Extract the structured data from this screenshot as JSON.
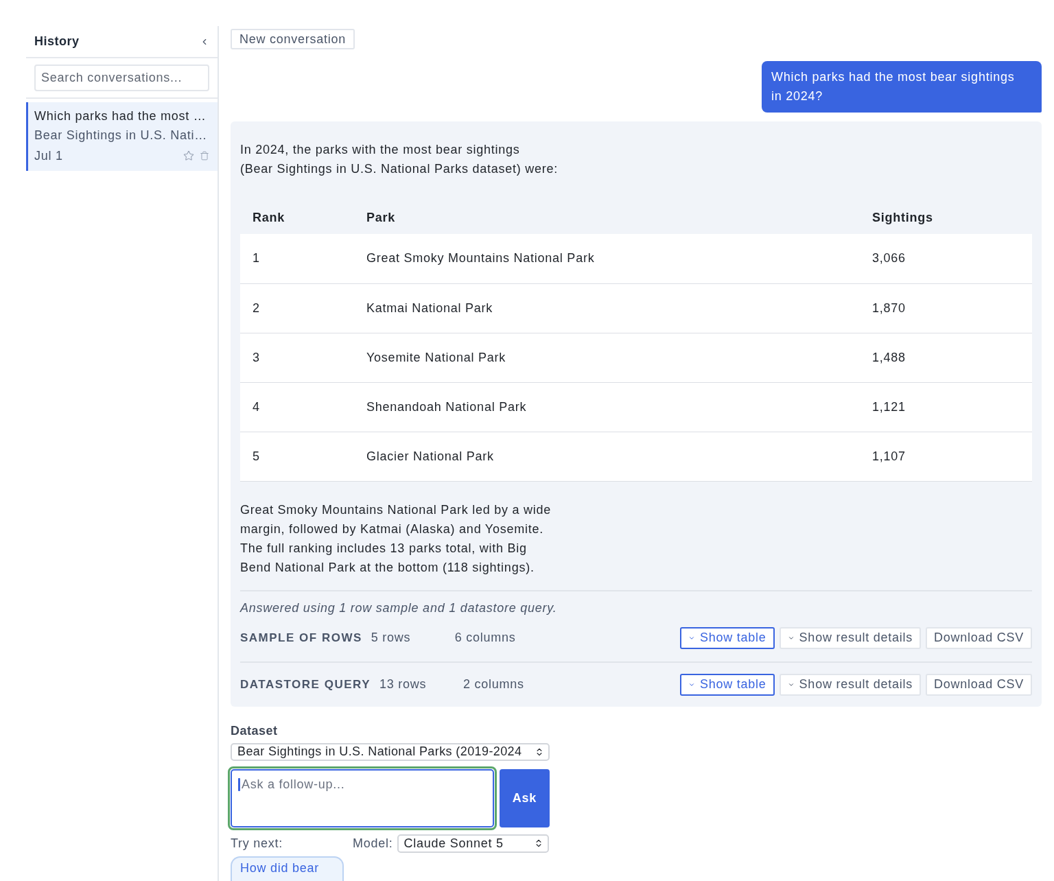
{
  "sidebar": {
    "title": "History",
    "search": {
      "placeholder": "Search conversations..."
    },
    "conversations": [
      {
        "title": "Which parks had the most …",
        "dataset": "Bear Sightings in U.S. Nati…",
        "date": "Jul 1",
        "selected": true,
        "starred": false
      }
    ]
  },
  "new_conversation_button": "New conversation",
  "messages": [
    {
      "kind": "user",
      "text": "Which parks had the most bear sightings in 2024?"
    },
    {
      "kind": "assistant",
      "intro": "In 2024, the parks with the most bear sightings\n(Bear Sightings in U.S. National Parks dataset) were:",
      "table": {
        "columns": [
          "Rank",
          "Park",
          "Sightings"
        ],
        "rows": [
          [
            "1",
            "Great Smoky Mountains National Park",
            "3,066"
          ],
          [
            "2",
            "Katmai National Park",
            "1,870"
          ],
          [
            "3",
            "Yosemite National Park",
            "1,488"
          ],
          [
            "4",
            "Shenandoah National Park",
            "1,121"
          ],
          [
            "5",
            "Glacier National Park",
            "1,107"
          ]
        ]
      },
      "summary": "Great Smoky Mountains National Park led by a wide margin, followed by Katmai (Alaska) and Yosemite. The full ranking includes 13 parks total, with Big Bend National Park at the bottom (118 sightings).",
      "footnote": "Answered using 1 row sample and 1 datastore query.",
      "sources": [
        {
          "label": "SAMPLE OF ROWS",
          "rows": "5 rows",
          "columns": "6 columns",
          "buttons": [
            {
              "label": "Show table",
              "kind": "primary"
            },
            {
              "label": "Show result details",
              "kind": "toggle"
            },
            {
              "label": "Download CSV",
              "kind": "plain"
            }
          ]
        },
        {
          "label": "DATASTORE QUERY",
          "rows": "13 rows",
          "columns": "2 columns",
          "buttons": [
            {
              "label": "Show table",
              "kind": "primary"
            },
            {
              "label": "Show result details",
              "kind": "toggle"
            },
            {
              "label": "Download CSV",
              "kind": "plain"
            }
          ]
        }
      ]
    }
  ],
  "composer": {
    "dataset_label": "Dataset",
    "dataset": "Bear Sightings in U.S. National Parks (2019-2024",
    "input": {
      "placeholder": "Ask a follow-up...",
      "focused": true
    },
    "ask_button": "Ask",
    "try_next_label": "Try next:",
    "model_label": "Model:",
    "model": "Claude Sonnet 5",
    "suggestions": [
      "How did bear"
    ]
  }
}
